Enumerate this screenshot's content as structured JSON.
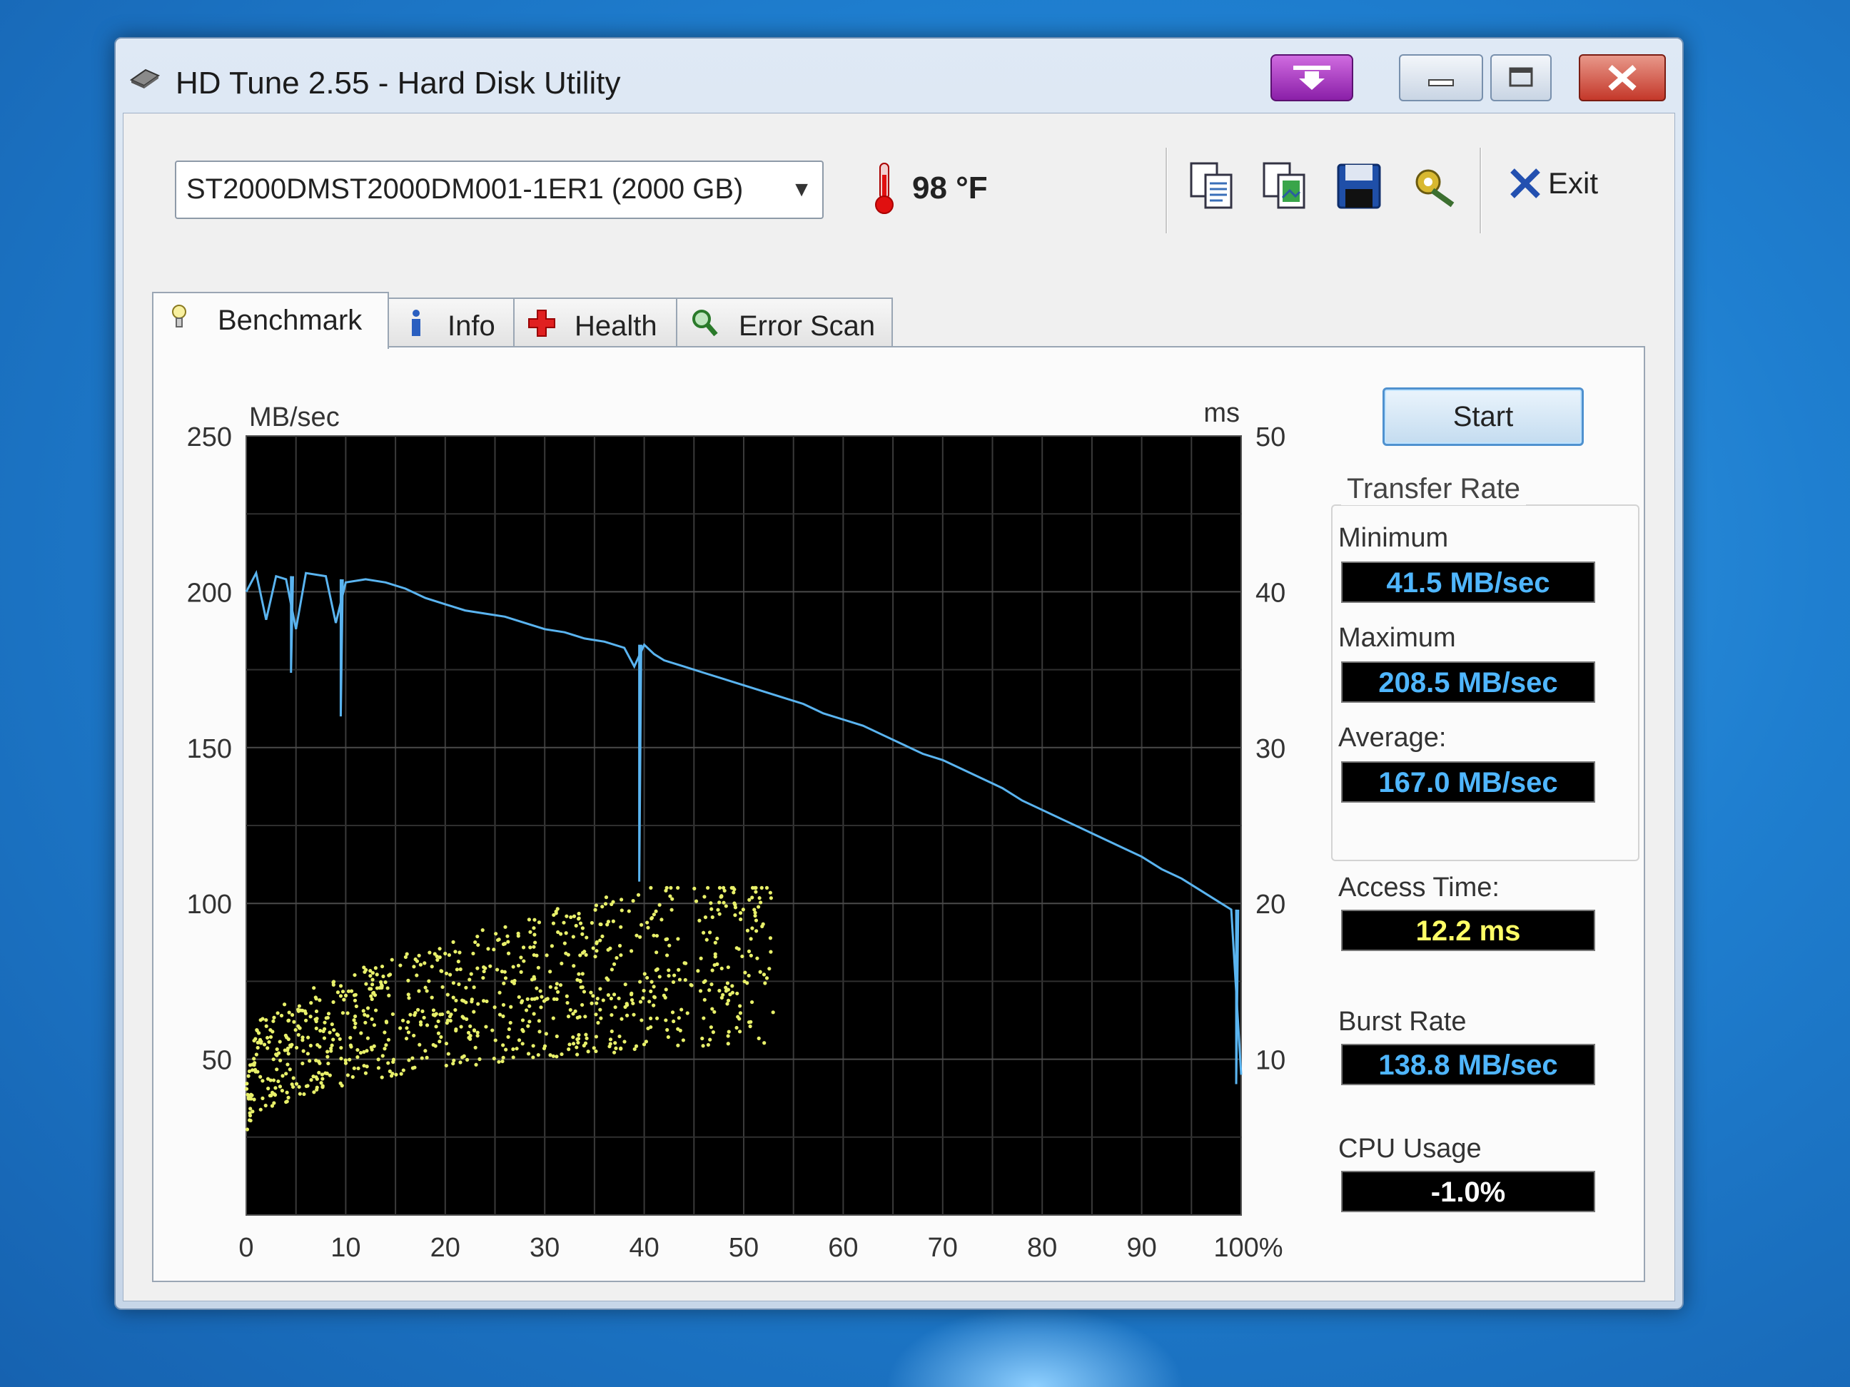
{
  "window": {
    "title": "HD Tune 2.55 - Hard Disk Utility"
  },
  "toolbar": {
    "drive": "ST2000DMST2000DM001-1ER1 (2000 GB)",
    "temperature": "98 °F",
    "exit_label": "Exit",
    "icons": [
      "copy-text-icon",
      "copy-screenshot-icon",
      "save-icon",
      "options-icon"
    ]
  },
  "tabs": [
    {
      "label": "Benchmark",
      "icon": "benchmark-icon",
      "active": true
    },
    {
      "label": "Info",
      "icon": "info-icon",
      "active": false
    },
    {
      "label": "Health",
      "icon": "health-icon",
      "active": false
    },
    {
      "label": "Error Scan",
      "icon": "error-scan-icon",
      "active": false
    }
  ],
  "benchmark": {
    "start_label": "Start",
    "transfer_rate_title": "Transfer Rate",
    "minimum_label": "Minimum",
    "minimum_value": "41.5 MB/sec",
    "maximum_label": "Maximum",
    "maximum_value": "208.5 MB/sec",
    "average_label": "Average:",
    "average_value": "167.0 MB/sec",
    "access_time_label": "Access Time:",
    "access_time_value": "12.2 ms",
    "burst_rate_label": "Burst Rate",
    "burst_rate_value": "138.8 MB/sec",
    "cpu_usage_label": "CPU Usage",
    "cpu_usage_value": "-1.0%",
    "value_color": "#4fb6ff",
    "access_color": "#ffff66"
  },
  "chart_data": {
    "type": "line",
    "left_axis_label": "MB/sec",
    "right_axis_label": "ms",
    "y_left_ticks": [
      250,
      200,
      150,
      100,
      50
    ],
    "y_right_ticks": [
      50,
      40,
      30,
      20,
      10
    ],
    "x_tick_labels": [
      "0",
      "10",
      "20",
      "30",
      "40",
      "50",
      "60",
      "70",
      "80",
      "90",
      "100%"
    ],
    "ylim_left": [
      0,
      250
    ],
    "ylim_right": [
      0,
      50
    ],
    "xlim": [
      0,
      100
    ],
    "grid": true,
    "background": "#000000",
    "series": [
      {
        "axis": "left",
        "color": "#5ab4f0",
        "x": [
          0,
          1,
          2,
          3,
          4,
          5,
          6,
          8,
          9,
          10,
          12,
          14,
          16,
          18,
          20,
          22,
          24,
          26,
          28,
          30,
          32,
          34,
          36,
          38,
          39,
          40,
          41,
          42,
          44,
          46,
          48,
          50,
          52,
          54,
          56,
          58,
          60,
          62,
          64,
          66,
          68,
          70,
          72,
          74,
          76,
          78,
          80,
          82,
          84,
          86,
          88,
          90,
          92,
          94,
          96,
          98,
          99,
          100
        ],
        "values": [
          200,
          206,
          191,
          205,
          204,
          188,
          206,
          205,
          190,
          203,
          204,
          203,
          201,
          198,
          196,
          194,
          193,
          192,
          190,
          188,
          187,
          185,
          184,
          182,
          176,
          183,
          180,
          178,
          176,
          174,
          172,
          170,
          168,
          166,
          164,
          161,
          159,
          157,
          154,
          151,
          148,
          146,
          143,
          140,
          137,
          133,
          130,
          127,
          124,
          121,
          118,
          115,
          111,
          108,
          104,
          100,
          98,
          45
        ]
      },
      {
        "axis": "left",
        "color": "#5ab4f0",
        "x": [
          4.5,
          4.5,
          4.7,
          9.5,
          9.5,
          9.7,
          39.5,
          39.5,
          39.7,
          99.5,
          99.5,
          99.7
        ],
        "values": [
          205,
          174,
          205,
          204,
          160,
          204,
          183,
          107,
          183,
          98,
          42,
          98
        ]
      },
      {
        "axis": "right",
        "type": "scatter",
        "color": "#e8f06a",
        "x_range": [
          0,
          53
        ],
        "y_range_ms": [
          3,
          21
        ]
      }
    ]
  }
}
